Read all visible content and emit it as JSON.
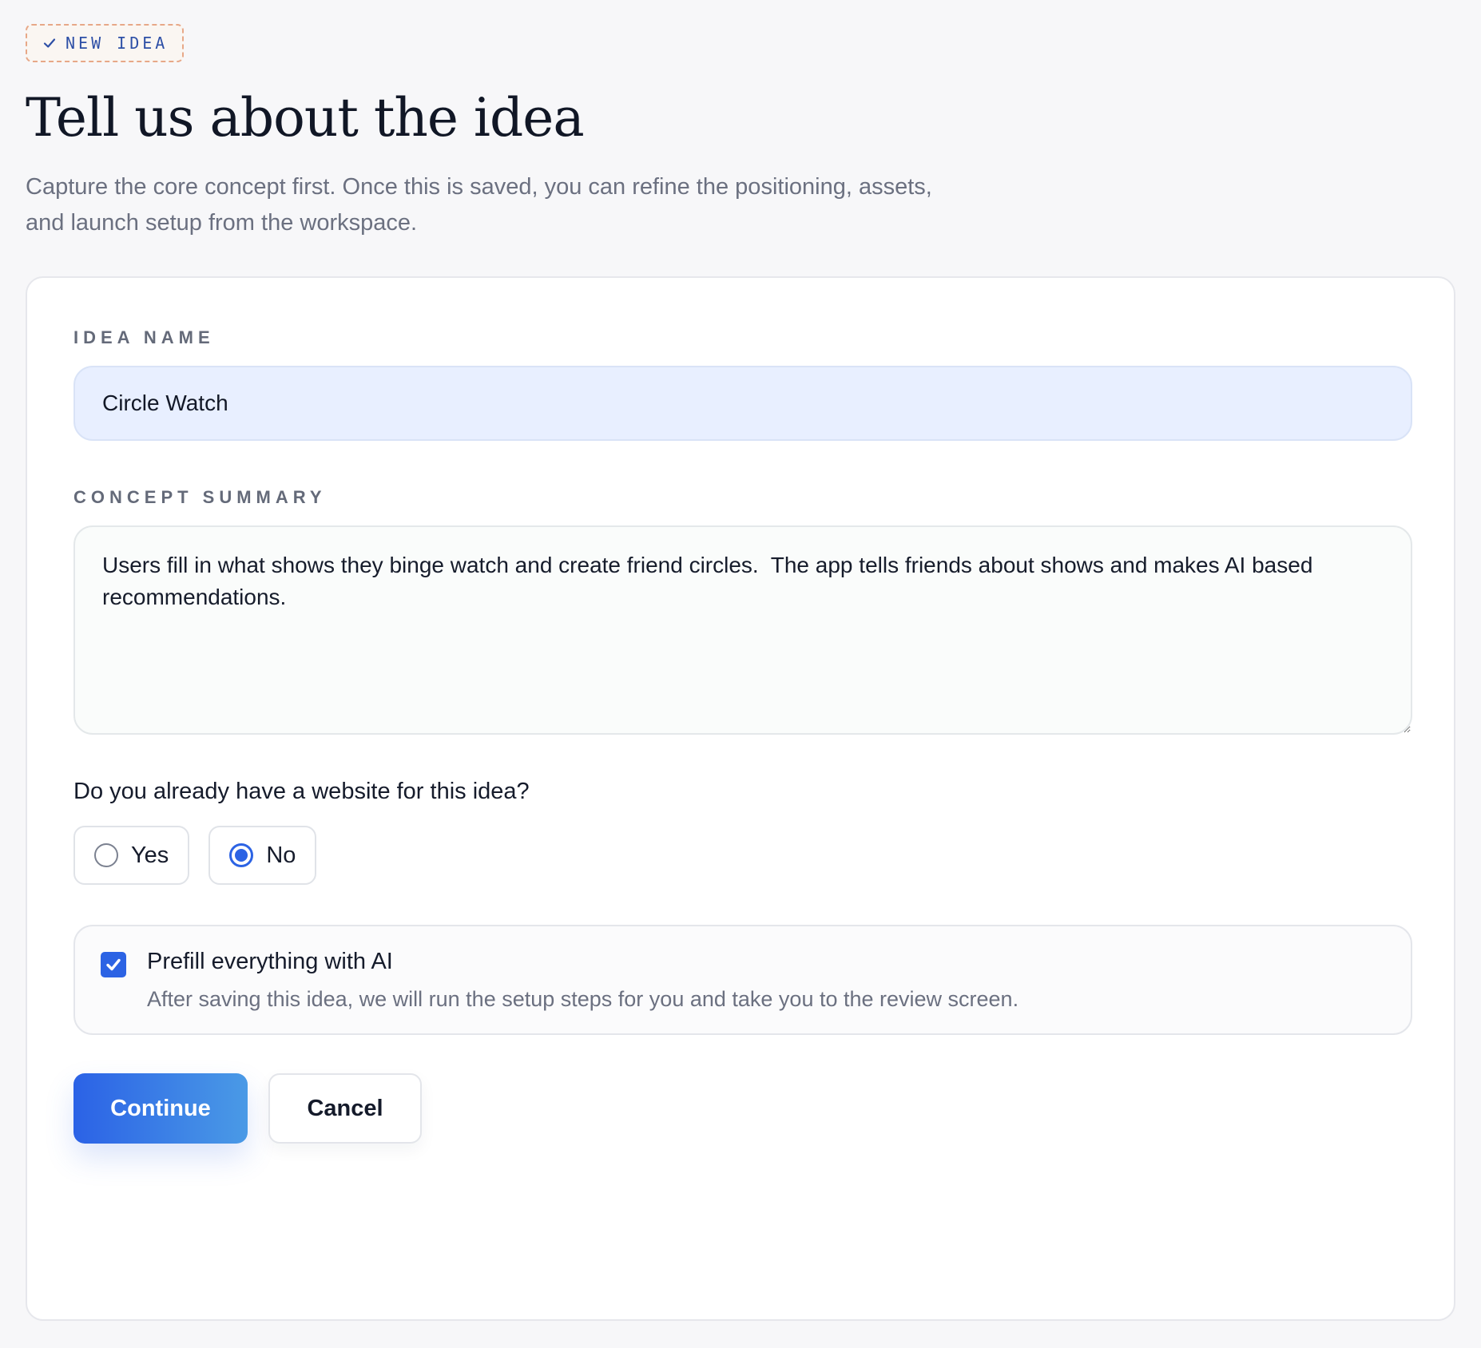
{
  "header": {
    "badge_label": "NEW IDEA",
    "badge_icon": "check-icon",
    "title": "Tell us about the idea",
    "subtitle": "Capture the core concept first. Once this is saved, you can refine the positioning, assets, and launch setup from the workspace."
  },
  "form": {
    "idea_name": {
      "label": "IDEA NAME",
      "value": "Circle Watch"
    },
    "concept_summary": {
      "label": "CONCEPT SUMMARY",
      "value": "Users fill in what shows they binge watch and create friend circles.  The app tells friends about shows and makes AI based recommendations."
    },
    "website_question": {
      "label": "Do you already have a website for this idea?",
      "options": [
        {
          "label": "Yes",
          "selected": false
        },
        {
          "label": "No",
          "selected": true
        }
      ]
    },
    "prefill": {
      "checked": true,
      "title": "Prefill everything with AI",
      "description": "After saving this idea, we will run the setup steps for you and take you to the review screen."
    }
  },
  "actions": {
    "continue_label": "Continue",
    "cancel_label": "Cancel"
  },
  "colors": {
    "accent": "#2c63e4",
    "badge_border": "#e7a888",
    "background": "#f7f7f9"
  }
}
